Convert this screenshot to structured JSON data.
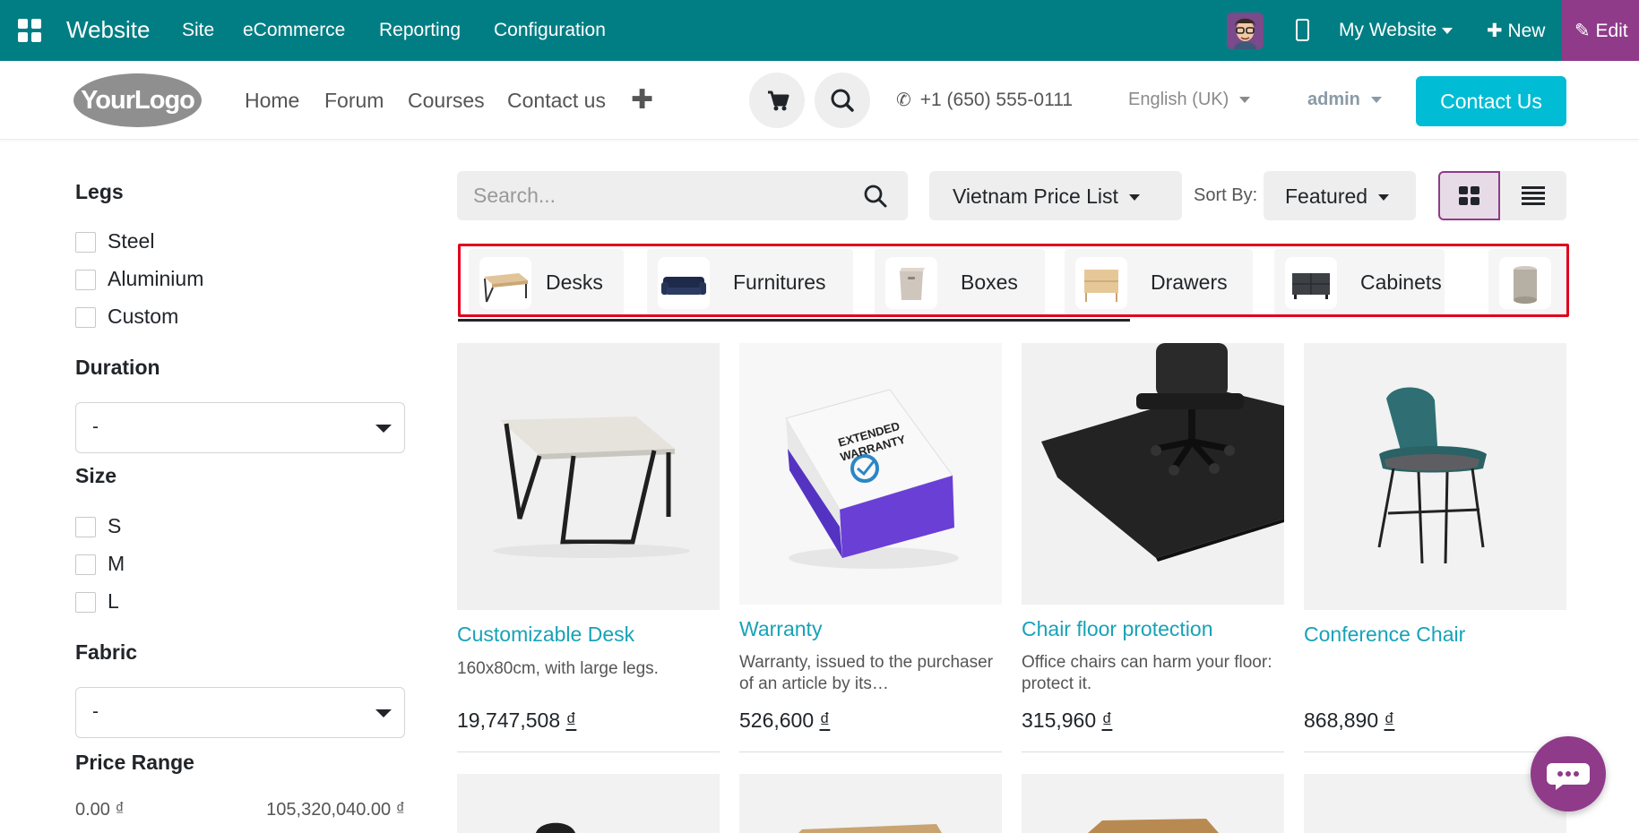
{
  "topbar": {
    "brand": "Website",
    "menu": [
      "Site",
      "eCommerce",
      "Reporting",
      "Configuration"
    ],
    "website_switcher": "My Website",
    "new_label": "New",
    "edit_label": "Edit"
  },
  "header": {
    "logo_text": "YourLogo",
    "nav": [
      "Home",
      "Forum",
      "Courses",
      "Contact us"
    ],
    "add_menu_glyph": "✚",
    "phone": "+1 (650) 555-0111",
    "language": "English (UK)",
    "user": "admin",
    "contact_button": "Contact Us"
  },
  "filters": {
    "legs": {
      "title": "Legs",
      "options": [
        "Steel",
        "Aluminium",
        "Custom"
      ]
    },
    "duration": {
      "title": "Duration",
      "value": "-"
    },
    "size": {
      "title": "Size",
      "options": [
        "S",
        "M",
        "L"
      ]
    },
    "fabric": {
      "title": "Fabric",
      "value": "-"
    },
    "price_range": {
      "title": "Price Range",
      "min": "0.00 ₫",
      "max": "105,320,040.00 ₫"
    }
  },
  "toolbar": {
    "search_placeholder": "Search...",
    "pricelist": "Vietnam Price List",
    "sort_label": "Sort By:",
    "sort_value": "Featured"
  },
  "categories": [
    "Desks",
    "Furnitures",
    "Boxes",
    "Drawers",
    "Cabinets"
  ],
  "products": [
    {
      "name": "Customizable Desk",
      "description": "160x80cm, with large legs.",
      "price": "19,747,508",
      "currency": "₫"
    },
    {
      "name": "Warranty",
      "description": "Warranty, issued to the purchaser of an article by its…",
      "price": "526,600",
      "currency": "₫",
      "box_text": "EXTENDED WARRANTY"
    },
    {
      "name": "Chair floor protection",
      "description": "Office chairs can harm your floor: protect it.",
      "price": "315,960",
      "currency": "₫"
    },
    {
      "name": "Conference Chair",
      "description": "",
      "price": "868,890",
      "currency": "₫"
    }
  ],
  "colors": {
    "topbar": "#017e84",
    "edit": "#8f3b8a",
    "accent": "#00bcd4",
    "product_link": "#17a2b8",
    "highlight": "#e0001b"
  }
}
